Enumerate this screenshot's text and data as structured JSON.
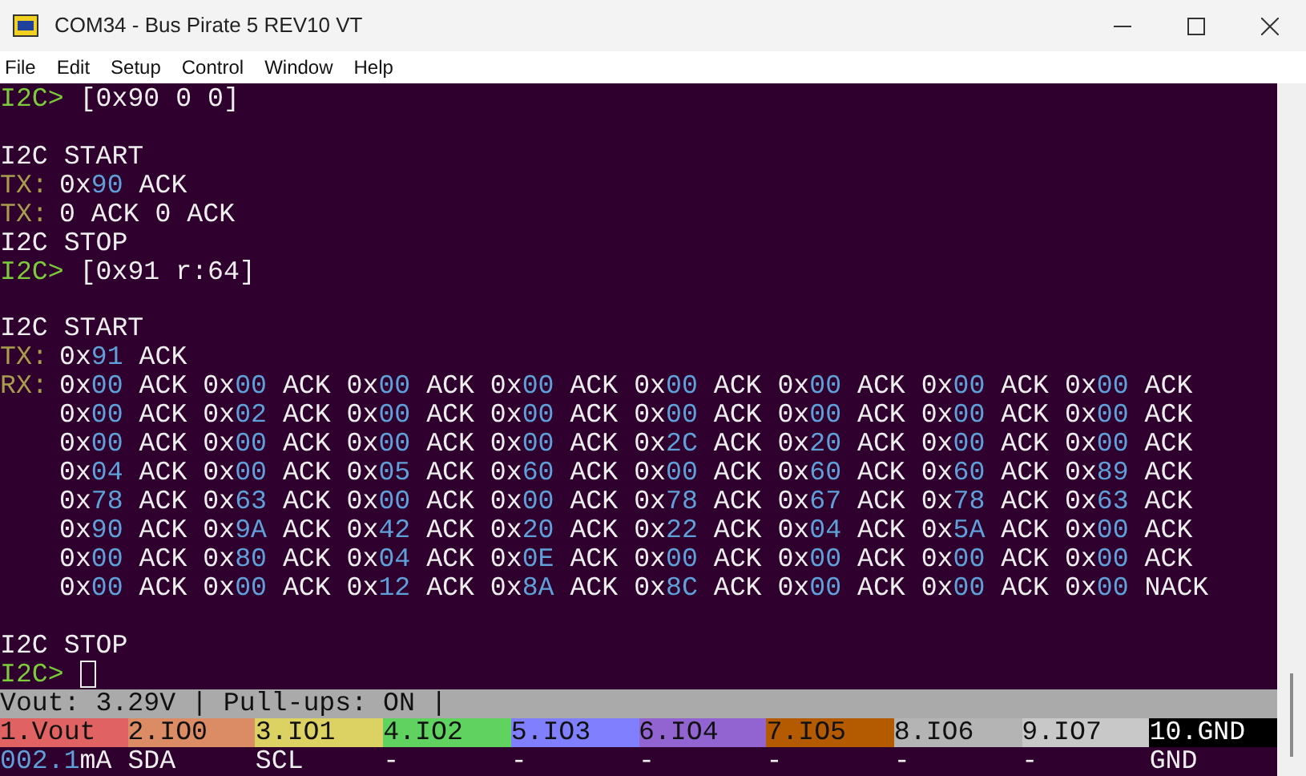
{
  "window": {
    "title": "COM34 - Bus Pirate 5 REV10 VT"
  },
  "menu": [
    "File",
    "Edit",
    "Setup",
    "Control",
    "Window",
    "Help"
  ],
  "terminal": {
    "lines": [
      {
        "kind": "prompt",
        "prompt": "I2C>",
        "text": "[0x90 0 0]"
      },
      {
        "kind": "blank"
      },
      {
        "kind": "text",
        "text": "I2C START"
      },
      {
        "kind": "tx",
        "label": "TX:",
        "text": "0x90 ACK"
      },
      {
        "kind": "tx",
        "label": "TX:",
        "text": "0 ACK 0 ACK"
      },
      {
        "kind": "text",
        "text": "I2C STOP"
      },
      {
        "kind": "prompt",
        "prompt": "I2C>",
        "text": "[0x91 r:64]"
      },
      {
        "kind": "blank"
      },
      {
        "kind": "text",
        "text": "I2C START"
      },
      {
        "kind": "tx",
        "label": "TX:",
        "text": "0x91 ACK"
      },
      {
        "kind": "rx",
        "label": "RX:",
        "text": "0x00 ACK 0x00 ACK 0x00 ACK 0x00 ACK 0x00 ACK 0x00 ACK 0x00 ACK 0x00 ACK"
      },
      {
        "kind": "rx",
        "text": "0x00 ACK 0x02 ACK 0x00 ACK 0x00 ACK 0x00 ACK 0x00 ACK 0x00 ACK 0x00 ACK"
      },
      {
        "kind": "rx",
        "text": "0x00 ACK 0x00 ACK 0x00 ACK 0x00 ACK 0x2C ACK 0x20 ACK 0x00 ACK 0x00 ACK"
      },
      {
        "kind": "rx",
        "text": "0x04 ACK 0x00 ACK 0x05 ACK 0x60 ACK 0x00 ACK 0x60 ACK 0x60 ACK 0x89 ACK"
      },
      {
        "kind": "rx",
        "text": "0x78 ACK 0x63 ACK 0x00 ACK 0x00 ACK 0x78 ACK 0x67 ACK 0x78 ACK 0x63 ACK"
      },
      {
        "kind": "rx",
        "text": "0x90 ACK 0x9A ACK 0x42 ACK 0x20 ACK 0x22 ACK 0x04 ACK 0x5A ACK 0x00 ACK"
      },
      {
        "kind": "rx",
        "text": "0x00 ACK 0x80 ACK 0x04 ACK 0x0E ACK 0x00 ACK 0x00 ACK 0x00 ACK 0x00 ACK"
      },
      {
        "kind": "rx",
        "text": "0x00 ACK 0x00 ACK 0x12 ACK 0x8A ACK 0x8C ACK 0x00 ACK 0x00 ACK 0x00 NACK"
      },
      {
        "kind": "blank"
      },
      {
        "kind": "text",
        "text": "I2C STOP"
      },
      {
        "kind": "prompt",
        "prompt": "I2C>",
        "cursor": true
      }
    ]
  },
  "status_bar": {
    "text": "Vout: 3.29V | Pull-ups: ON |",
    "pins": [
      {
        "label": "1.Vout",
        "color": "#e06262",
        "value": "002.1",
        "unit": "mA"
      },
      {
        "label": "2.IO0",
        "color": "#dc8c64",
        "value": "SDA"
      },
      {
        "label": "3.IO1",
        "color": "#dcd264",
        "value": "SCL"
      },
      {
        "label": "4.IO2",
        "color": "#5fd25f",
        "value": "-"
      },
      {
        "label": "5.IO3",
        "color": "#8080ff",
        "value": "-"
      },
      {
        "label": "6.IO4",
        "color": "#9264d2",
        "value": "-"
      },
      {
        "label": "7.IO5",
        "color": "#b45a00",
        "value": "-"
      },
      {
        "label": "8.IO6",
        "color": "#b4b4b4",
        "value": "-"
      },
      {
        "label": "9.IO7",
        "color": "#c8c8c8",
        "value": "-"
      },
      {
        "label": "10.GND",
        "color": "#000000",
        "value": "GND"
      }
    ]
  }
}
